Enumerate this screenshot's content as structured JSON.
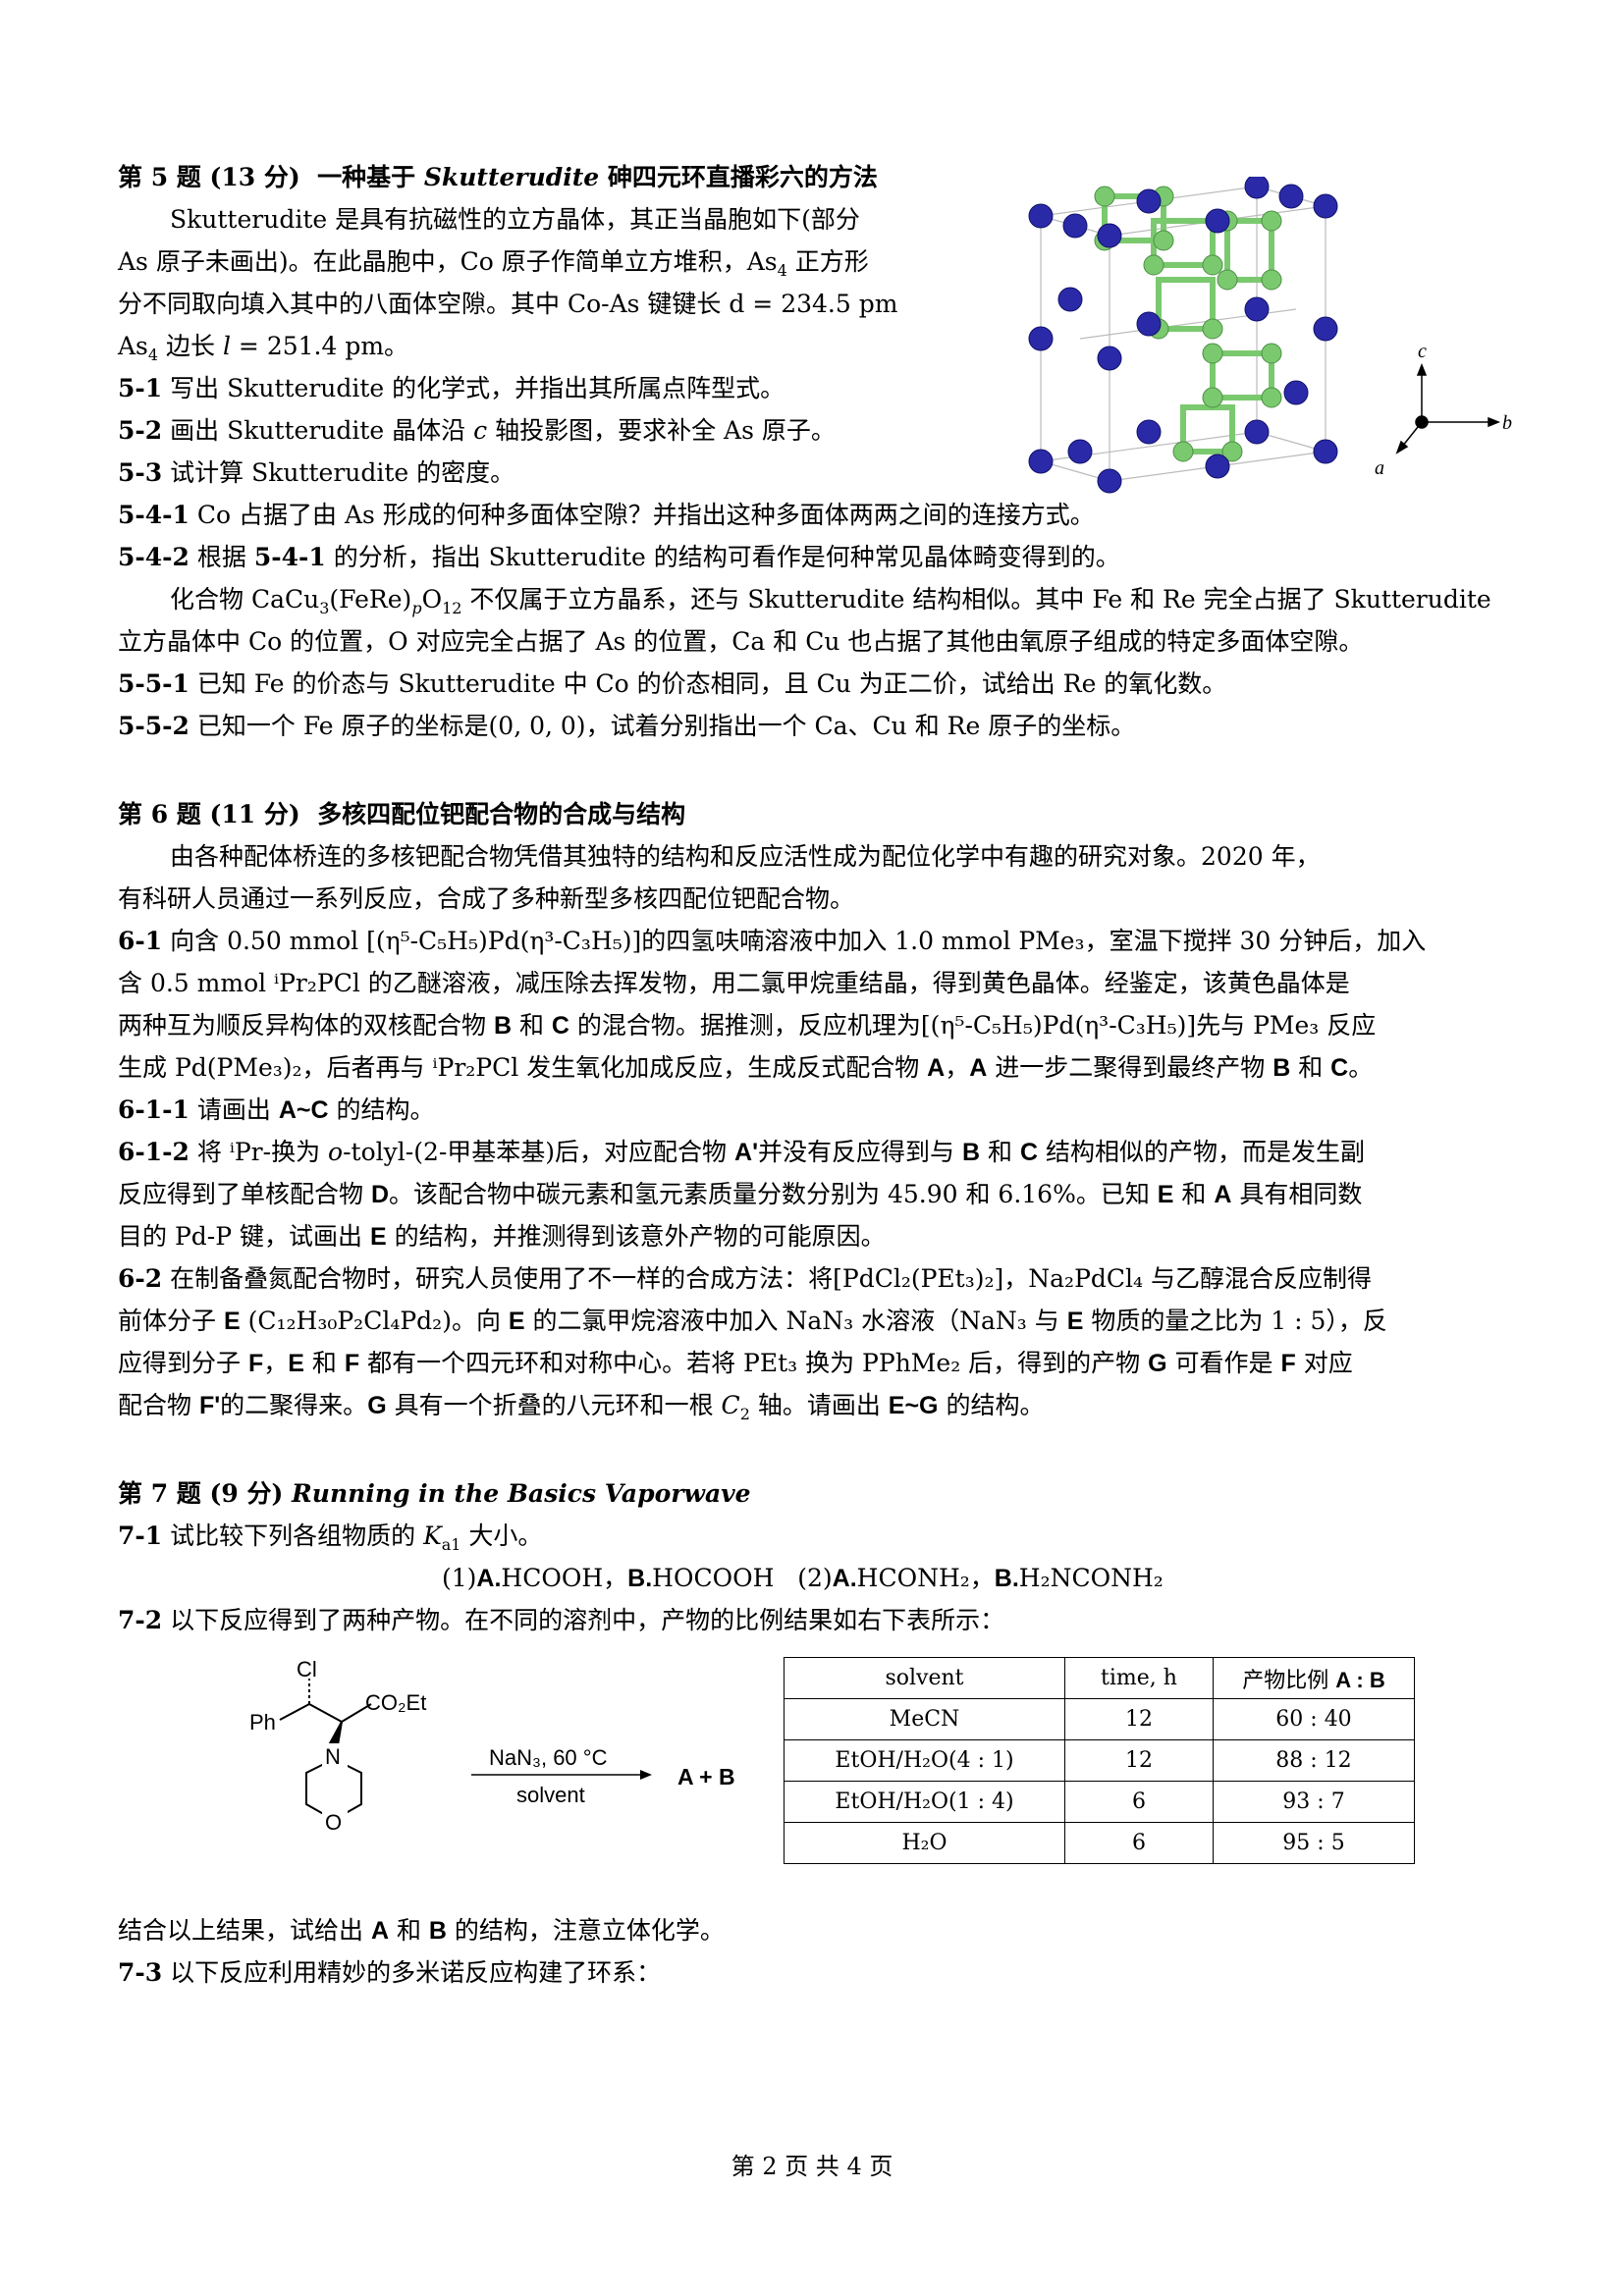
{
  "q5": {
    "title_num": "第 5 题",
    "title_pts": "(13 分)",
    "title_a": "一种基于",
    "title_it": "Skutterudite",
    "title_b": "砷四元环直播彩六的方法",
    "p1a": "Skutterudite 是具有抗磁性的立方晶体，其正当晶胞如下(部分",
    "p1b": "As 原子未画出)。在此晶胞中，Co 原子作简单立方堆积，As",
    "p1b_sub": "4",
    "p1b2": " 正方形",
    "p1c": "分不同取向填入其中的八面体空隙。其中 Co-As 键键长 d = 234.5 pm",
    "p1d": "As",
    "p1d_sub": "4",
    "p1d2": " 边长 ",
    "p1d_l": "l",
    "p1d3": " = 251.4 pm。",
    "q51_lbl": "5-1",
    "q51": " 写出 Skutterudite 的化学式，并指出其所属点阵型式。",
    "q52_lbl": "5-2",
    "q52a": " 画出 Skutterudite 晶体沿 ",
    "q52c": "c",
    "q52b": " 轴投影图，要求补全 As 原子。",
    "q53_lbl": "5-3",
    "q53": " 试计算 Skutterudite 的密度。",
    "q541_lbl": "5-4-1",
    "q541": " Co 占据了由 As 形成的何种多面体空隙？并指出这种多面体两两之间的连接方式。",
    "q542_lbl": "5-4-2",
    "q542a": "  根据 ",
    "q542b": "5-4-1",
    "q542c": " 的分析，指出 Skutterudite 的结构可看作是何种常见晶体畸变得到的。",
    "p2a": "化合物 CaCu",
    "p2a_sub": "3",
    "p2b": "(FeRe)",
    "p2b_sub": "p",
    "p2c": "O",
    "p2c_sub": "12",
    "p2d": " 不仅属于立方晶系，还与 Skutterudite 结构相似。其中 Fe 和 Re 完全占据了 Skutterudite",
    "p2e": "立方晶体中 Co 的位置，O 对应完全占据了 As 的位置，Ca 和 Cu 也占据了其他由氧原子组成的特定多面体空隙。",
    "q551_lbl": "5-5-1",
    "q551": " 已知 Fe 的价态与 Skutterudite 中 Co 的价态相同，且 Cu 为正二价，试给出 Re 的氧化数。",
    "q552_lbl": "5-5-2",
    "q552": " 已知一个 Fe 原子的坐标是(0, 0, 0)，试着分别指出一个 Ca、Cu 和 Re 原子的坐标。",
    "axis_c": "c",
    "axis_b": "b",
    "axis_a": "a"
  },
  "q6": {
    "title_num": "第 6 题",
    "title_pts": "(11 分)",
    "title": "多核四配位钯配合物的合成与结构",
    "p1a": "由各种配体桥连的多核钯配合物凭借其独特的结构和反应活性成为配位化学中有趣的研究对象。2020 年，",
    "p1b": "有科研人员通过一系列反应，合成了多种新型多核四配位钯配合物。",
    "q61_lbl": "6-1",
    "l1": "  向含 0.50 mmol [(η⁵-C₅H₅)Pd(η³-C₃H₅)]的四氢呋喃溶液中加入 1.0 mmol PMe₃，室温下搅拌 30 分钟后，加入",
    "l2": "含 0.5 mmol ⁱPr₂PCl 的乙醚溶液，减压除去挥发物，用二氯甲烷重结晶，得到黄色晶体。经鉴定，该黄色晶体是",
    "l3a": "两种互为顺反异构体的双核配合物 ",
    "B": "B",
    "and": " 和 ",
    "C": "C",
    "l3b": " 的混合物。据推测，反应机理为[(η⁵-C₅H₅)Pd(η³-C₃H₅)]先与 PMe₃ 反应",
    "l4a": "生成 Pd(PMe₃)₂，后者再与 ⁱPr₂PCl 发生氧化加成反应，生成反式配合物 ",
    "A": "A",
    "l4b": "，",
    "l4c": " 进一步二聚得到最终产物 ",
    "l4d": "。",
    "q611_lbl": "6-1-1",
    "q611a": "  请画出 ",
    "AC": "A~C",
    "q611b": " 的结构。",
    "q612_lbl": "6-1-2",
    "q612a": "  将 ⁱPr-换为 ",
    "otolyl": "o",
    "q612b": "-tolyl-(2-甲基苯基)后，对应配合物 ",
    "Ap": "A'",
    "q612c": "并没有反应得到与 ",
    "q612d": " 结构相似的产物，而是发生副",
    "l6a": "反应得到了单核配合物 ",
    "D": "D",
    "l6b": "。该配合物中碳元素和氢元素质量分数分别为 45.90 和 6.16%。已知 ",
    "E": "E",
    "l6c": " 具有相同数",
    "l7a": "目的 Pd-P 键，试画出 ",
    "l7b": " 的结构，并推测得到该意外产物的可能原因。",
    "q62_lbl": "6-2",
    "l8": "  在制备叠氮配合物时，研究人员使用了不一样的合成方法：将[PdCl₂(PEt₃)₂]，Na₂PdCl₄ 与乙醇混合反应制得",
    "l9a": "前体分子 ",
    "l9b": " (C₁₂H₃₀P₂Cl₄Pd₂)。向 ",
    "l9c": " 的二氯甲烷溶液中加入 NaN₃ 水溶液（NaN₃ 与 ",
    "l9d": " 物质的量之比为 1 : 5），反",
    "l10a": "应得到分子 ",
    "F": "F",
    "l10b": "，",
    "l10c": " 都有一个四元环和对称中心。若将 PEt₃ 换为 PPhMe₂ 后，得到的产物 ",
    "G": "G",
    "l10d": " 可看作是 ",
    "l10e": " 对应",
    "l11a": "配合物 ",
    "Fp": "F'",
    "l11b": "的二聚得来。",
    "l11c": " 具有一个折叠的八元环和一根 ",
    "C2": "C",
    "C2sub": "2",
    "l11d": " 轴。请画出 ",
    "EG": "E~G",
    "l11e": " 的结构。"
  },
  "q7": {
    "title_num": "第 7 题",
    "title_pts": "(9 分)",
    "title": "Running in the Basics Vaporwave",
    "q71_lbl": "7-1",
    "q71a": "  试比较下列各组物质的 ",
    "Ka": "K",
    "Ka_sub": "a1",
    "q71b": " 大小。",
    "pairs1": "(1)",
    "pA": "A.",
    "p1A": "HCOOH，",
    "pB": "B.",
    "p1B": "HOCOOH",
    "pairs2": "(2)",
    "p2A": "HCONH₂，",
    "p2B": "H₂NCONH₂",
    "q72_lbl": "7-2",
    "q72": "  以下反应得到了两种产物。在不同的溶剂中，产物的比例结果如右下表所示：",
    "reagent1": "NaN₃, 60 °C",
    "reagent2": "solvent",
    "product": "A + B",
    "struct_cl": "Cl",
    "struct_ph": "Ph",
    "struct_co2et": "CO₂Et",
    "struct_n": "N",
    "struct_o": "O",
    "table_header": [
      "solvent",
      "time, h",
      "产物比例 "
    ],
    "table_header_ab": "A : B",
    "table_rows": [
      [
        "MeCN",
        "12",
        "60 : 40"
      ],
      [
        "EtOH/H₂O(4 : 1)",
        "12",
        "88 : 12"
      ],
      [
        "EtOH/H₂O(1 : 4)",
        "6",
        "93 : 7"
      ],
      [
        "H₂O",
        "6",
        "95 : 5"
      ]
    ],
    "q72b_a": "结合以上结果，试给出 ",
    "q72b_b": " 和 ",
    "q72b_c": " 的结构，注意立体化学。",
    "q73_lbl": "7-3",
    "q73": "  以下反应利用精妙的多米诺反应构建了环系："
  },
  "footer": "第 2 页 共 4 页"
}
